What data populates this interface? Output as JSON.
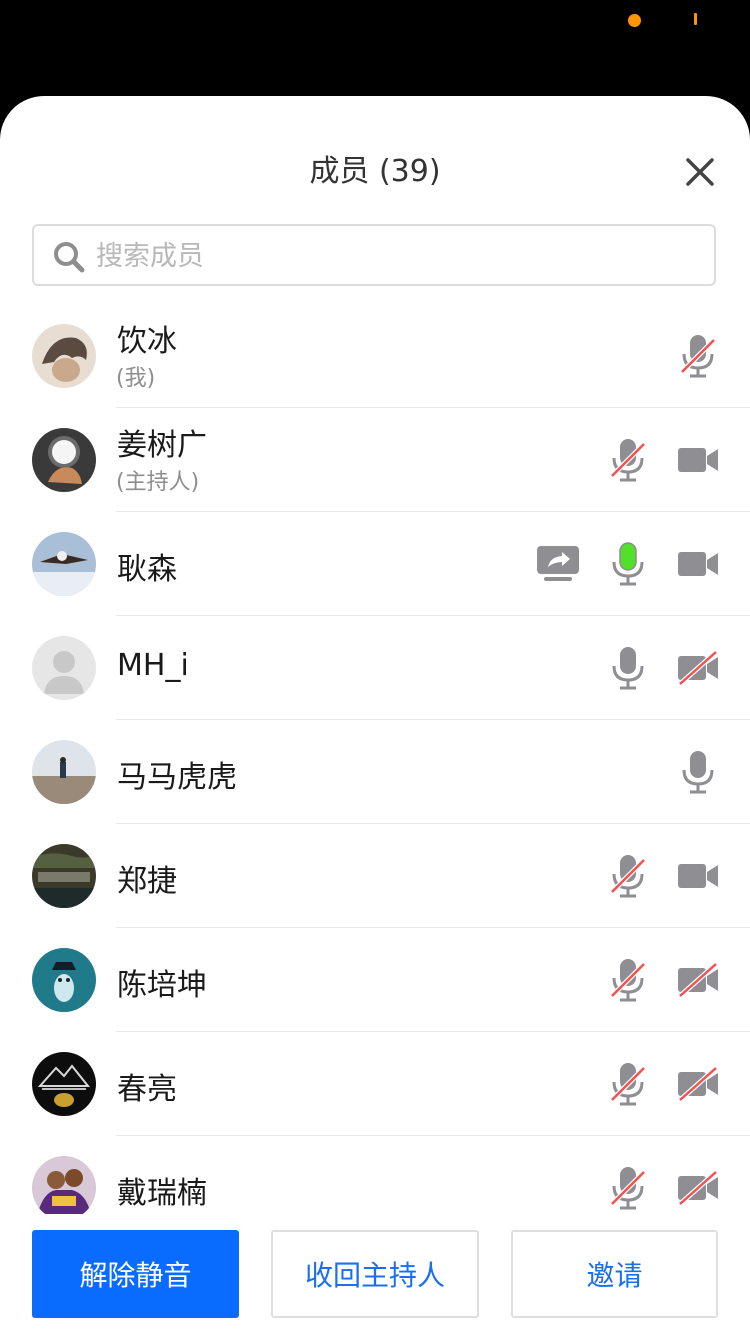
{
  "header": {
    "title": "成员 (39)"
  },
  "search": {
    "placeholder": "搜索成员"
  },
  "members": [
    {
      "name": "饮冰",
      "role": "(我)",
      "icons": [
        "",
        "",
        "mic-muted"
      ]
    },
    {
      "name": "姜树广",
      "role": "(主持人)",
      "icons": [
        "",
        "mic-muted",
        "camera"
      ]
    },
    {
      "name": "耿森",
      "role": "",
      "icons": [
        "screen-share",
        "mic-speaking",
        "camera"
      ]
    },
    {
      "name": "MH_i",
      "role": "",
      "icons": [
        "",
        "mic",
        "camera-off"
      ]
    },
    {
      "name": "马马虎虎",
      "role": "",
      "icons": [
        "",
        "",
        "mic"
      ]
    },
    {
      "name": "郑捷",
      "role": "",
      "icons": [
        "",
        "mic-muted",
        "camera"
      ]
    },
    {
      "name": "陈培坤",
      "role": "",
      "icons": [
        "",
        "mic-muted",
        "camera-off"
      ]
    },
    {
      "name": "春亮",
      "role": "",
      "icons": [
        "",
        "mic-muted",
        "camera-off"
      ]
    },
    {
      "name": "戴瑞楠",
      "role": "",
      "icons": [
        "",
        "mic-muted",
        "camera-off"
      ]
    }
  ],
  "actions": {
    "unmute_label": "解除静音",
    "reclaim_host_label": "收回主持人",
    "invite_label": "邀请"
  },
  "colors": {
    "primary": "#0a6cff",
    "speaking": "#52e028",
    "muted_slash": "#f0524f",
    "icon_gray": "#8e8e93",
    "status_accent": "#ff9500"
  }
}
